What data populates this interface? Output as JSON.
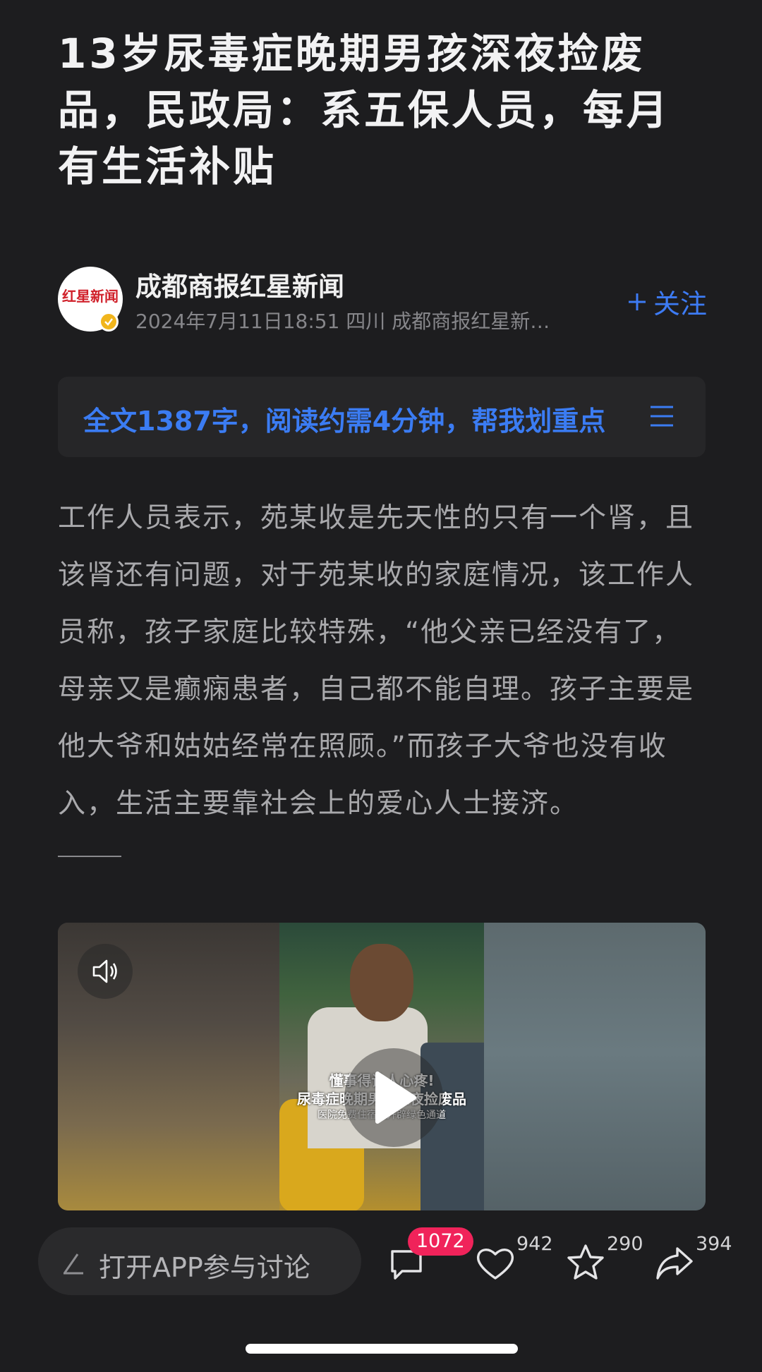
{
  "article": {
    "title": "13岁尿毒症晚期男孩深夜捡废品，民政局：系五保人员，每月有生活补贴",
    "author": {
      "name": "成都商报红星新闻",
      "meta": "2024年7月11日18:51 四川  成都商报红星新…",
      "avatar_logo": "红星新闻",
      "follow_label": "关注"
    },
    "summary": {
      "text": "全文1387字，阅读约需4分钟，帮我划重点"
    },
    "body": "工作人员表示，苑某收是先天性的只有一个肾，且该肾还有问题，对于苑某收的家庭情况，该工作人员称，孩子家庭比较特殊，“他父亲已经没有了，母亲又是癫痫患者，自己都不能自理。孩子主要是他大爷和姑姑经常在照顾。”而孩子大爷也没有收入，生活主要靠社会上的爱心人士接济。",
    "video": {
      "caption_line1": "懂事得让人心疼!",
      "caption_line2": "尿毒症晚期男孩深夜捡废品",
      "caption_line3": "医院免费住宿我开辟绿色通道"
    }
  },
  "bottom_bar": {
    "comment_placeholder": "打开APP参与讨论",
    "comments_count": "1072",
    "likes_count": "942",
    "favorites_count": "290",
    "shares_count": "394"
  },
  "colors": {
    "background": "#1d1d1f",
    "accent_blue": "#3b7cf3",
    "badge_red": "#f0235a",
    "verified_gold": "#f1b51c"
  },
  "icons": [
    "plus-icon",
    "menu-icon",
    "volume-icon",
    "play-icon",
    "pen-icon",
    "comment-icon",
    "heart-icon",
    "star-icon",
    "share-icon",
    "verified-icon"
  ]
}
